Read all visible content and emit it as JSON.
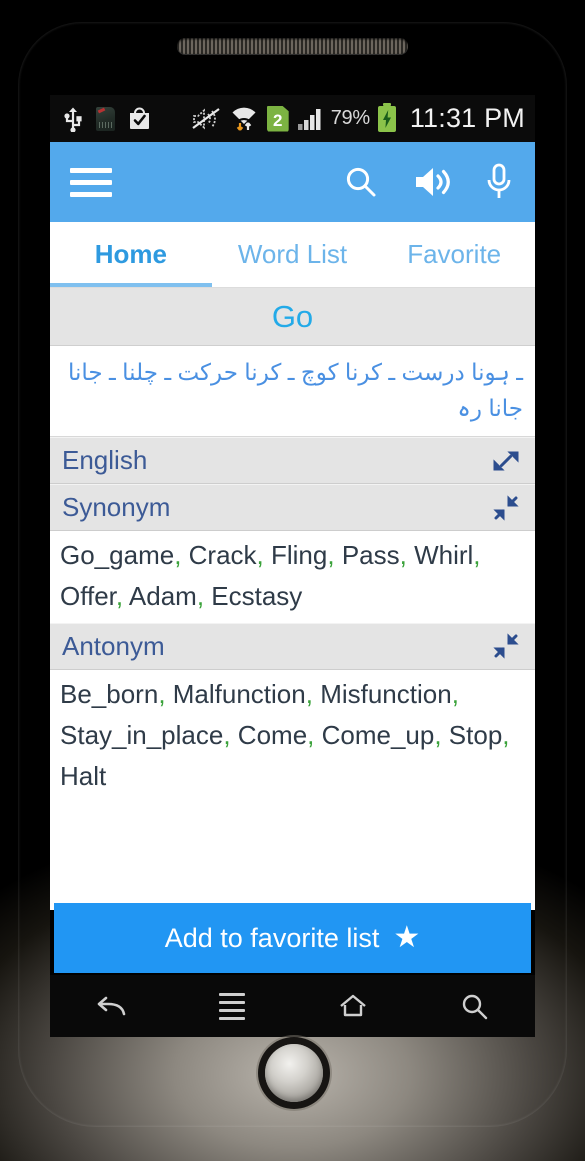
{
  "device": {
    "speaker_grille": "speaker-grille",
    "home_button": "home-trackball"
  },
  "status_bar": {
    "icons": [
      {
        "name": "usb-icon",
        "glyph": "Ψ"
      },
      {
        "name": "sd-card-icon",
        "glyph": ""
      },
      {
        "name": "play-store-download-complete-icon",
        "glyph": ""
      },
      {
        "name": "volume-muted-icon",
        "glyph": ""
      },
      {
        "name": "wifi-transfer-icon",
        "glyph": ""
      },
      {
        "name": "sim2-icon",
        "label": "2"
      },
      {
        "name": "signal-bars-icon",
        "glyph": ""
      }
    ],
    "sim_label": "2",
    "battery_percent": "79%",
    "battery_state": "charging",
    "clock": "11:31 PM"
  },
  "app_bar": {
    "menu_icon": "hamburger-menu-icon",
    "actions": [
      {
        "name": "search-icon",
        "label": "Search"
      },
      {
        "name": "speaker-icon",
        "label": "Pronounce"
      },
      {
        "name": "microphone-icon",
        "label": "Voice search"
      }
    ],
    "background_color": "#53a9ec"
  },
  "tabs": [
    {
      "label": "Home",
      "active": true
    },
    {
      "label": "Word List",
      "active": false
    },
    {
      "label": "Favorite",
      "active": false
    }
  ],
  "entry": {
    "word": "Go",
    "word_color": "#23aae8",
    "urdu_meaning": "ـ ہونا درست ـ کرنا کوچ ـ کرنا حرکت ـ چلنا ـ جانا جانا رہ",
    "urdu_color": "#4a90e2"
  },
  "sections": [
    {
      "title": "English",
      "expanded": false,
      "toggle_icon": "expand-icon",
      "words": []
    },
    {
      "title": "Synonym",
      "expanded": true,
      "toggle_icon": "collapse-icon",
      "words": [
        "Go_game",
        "Crack",
        "Fling",
        "Pass",
        "Whirl",
        "Offer",
        "Adam",
        "Ecstasy"
      ]
    },
    {
      "title": "Antonym",
      "expanded": true,
      "toggle_icon": "collapse-icon",
      "words": [
        "Be_born",
        "Malfunction",
        "Misfunction",
        "Stay_in_place",
        "Come",
        "Come_up",
        "Stop",
        "Halt"
      ]
    }
  ],
  "favorite_button": {
    "label": "Add to favorite list",
    "icon": "star-icon",
    "star": "★",
    "background_color": "#2196f3"
  },
  "nav_bar": [
    {
      "name": "nav-back-button",
      "label": "Back"
    },
    {
      "name": "nav-menu-button",
      "label": "Menu"
    },
    {
      "name": "nav-home-button",
      "label": "Home"
    },
    {
      "name": "nav-search-button",
      "label": "Search"
    }
  ],
  "colors": {
    "accent_blue": "#53a9ec",
    "button_blue": "#2196f3",
    "section_header_bg": "#e4e4e4",
    "section_header_text": "#3c5a96",
    "word_text": "#2f3b48",
    "comma_green": "#3aa23a"
  }
}
